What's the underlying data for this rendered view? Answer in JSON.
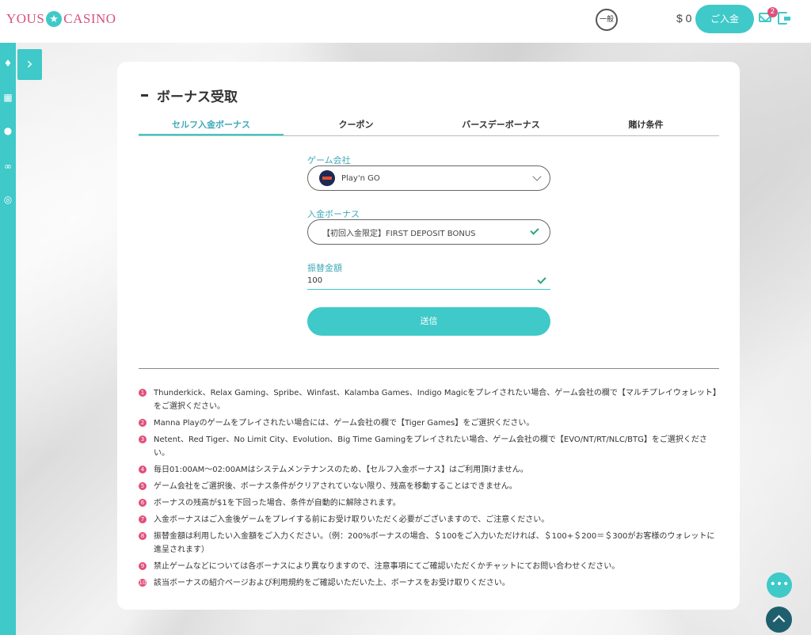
{
  "header": {
    "logo_left": "YOUS",
    "logo_star": "★",
    "logo_right": "CASINO",
    "circle_text": "一般",
    "balance": "$ 0",
    "deposit_label": "ご入金",
    "mail_badge": "2"
  },
  "sidebar": {
    "icons": [
      "medal-icon",
      "grid-icon",
      "info-icon",
      "link-icon",
      "globe-icon"
    ],
    "toggle_glyph": "›"
  },
  "page": {
    "title": "ボーナス受取",
    "tabs": [
      {
        "label": "セルフ入金ボーナス",
        "active": true
      },
      {
        "label": "クーポン",
        "active": false
      },
      {
        "label": "バースデーボーナス",
        "active": false
      },
      {
        "label": "賭け条件",
        "active": false
      }
    ]
  },
  "form": {
    "provider_label": "ゲーム会社",
    "provider_value": "Play'n GO",
    "bonus_label": "入金ボーナス",
    "bonus_value": "【初回入金限定】FIRST DEPOSIT BONUS",
    "amount_label": "振替金額",
    "amount_value": "100",
    "submit_label": "送信"
  },
  "notes": [
    "Thunderkick、Relax Gaming、Spribe、Winfast、Kalamba Games、Indigo Magicをプレイされたい場合、ゲーム会社の欄で【マルチプレイウォレット】をご選択ください。",
    "Manna Playのゲームをプレイされたい場合には、ゲーム会社の欄で【Tiger Games】をご選択ください。",
    "Netent、Red Tiger、No Limit City、Evolution、Big Time Gamingをプレイされたい場合、ゲーム会社の欄で【EVO/NT/RT/NLC/BTG】をご選択ください。",
    "毎日01:00AM〜02:00AMはシステムメンテナンスのため、【セルフ入金ボーナス】はご利用頂けません。",
    "ゲーム会社をご選択後、ボーナス条件がクリアされていない限り、残高を移動することはできません。",
    "ボーナスの残高が$1を下回った場合、条件が自動的に解除されます。",
    "入金ボーナスはご入金後ゲームをプレイする前にお受け取りいただく必要がございますので、ご注意ください。",
    "振替金額は利用したい入金額をご入力ください。（例：200%ボーナスの場合、＄100をご入力いただければ、＄100+＄200＝＄300がお客様のウォレットに進呈されます）",
    "禁止ゲームなどについては各ボーナスにより異なりますので、注意事項にてご確認いただくかチャットにてお問い合わせください。",
    "該当ボーナスの紹介ページおよび利用規約をご確認いただいた上、ボーナスをお受け取りください。"
  ],
  "note_numbers": [
    "1",
    "2",
    "3",
    "4",
    "5",
    "6",
    "7",
    "8",
    "9",
    "10"
  ],
  "colors": {
    "accent": "#3fc9c9",
    "badge": "#e0507a",
    "scroll_top": "#1f5f6d"
  }
}
